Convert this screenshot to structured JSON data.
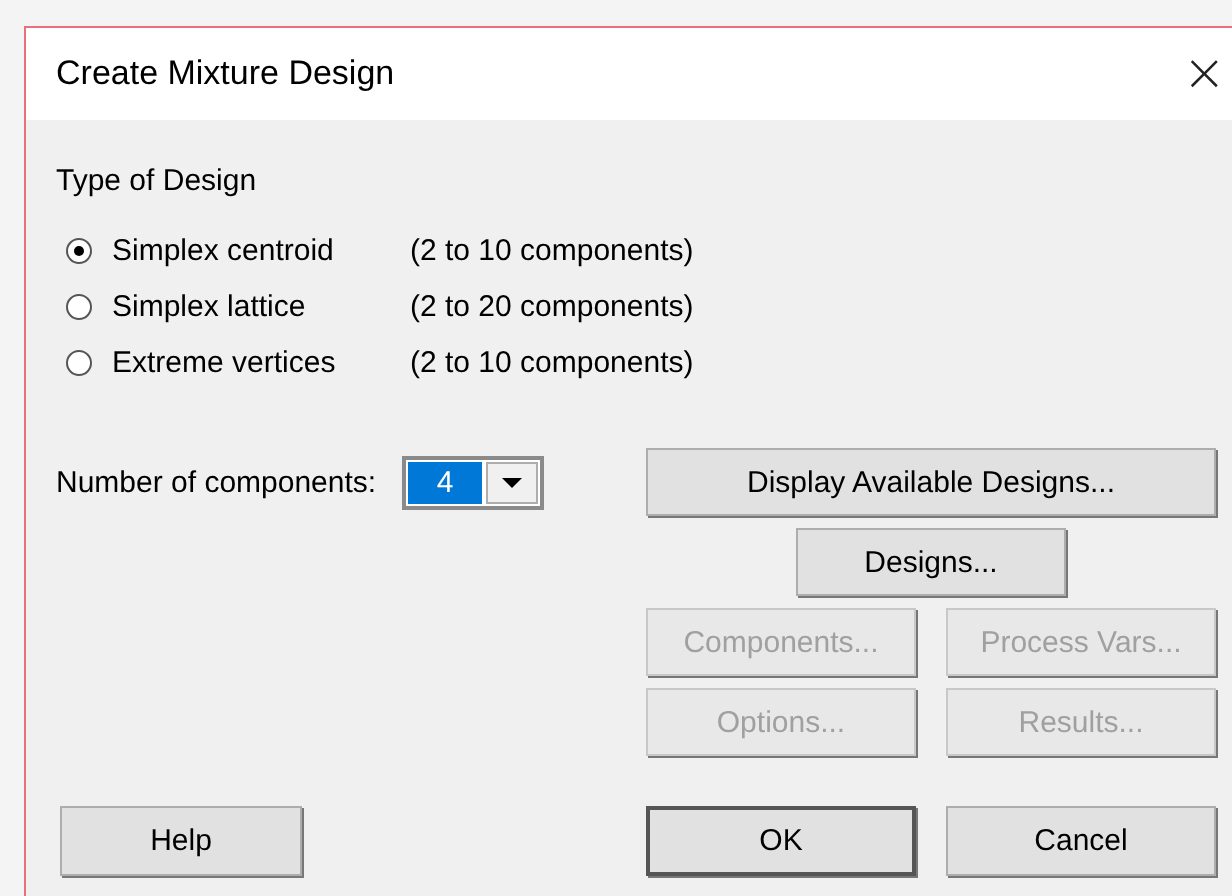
{
  "window": {
    "title": "Create Mixture Design",
    "close": "×"
  },
  "type_of_design": {
    "label": "Type of Design",
    "options": [
      {
        "label": "Simplex centroid",
        "range": "(2 to 10 components)",
        "selected": true
      },
      {
        "label": "Simplex lattice",
        "range": "(2 to 20 components)",
        "selected": false
      },
      {
        "label": "Extreme vertices",
        "range": "(2 to 10 components)",
        "selected": false
      }
    ]
  },
  "number_of_components": {
    "label": "Number of components:",
    "value": "4"
  },
  "buttons": [
    {
      "label": "Display Available Designs...",
      "disabled": false,
      "default": false
    },
    {
      "label": "Designs...",
      "disabled": false,
      "default": false
    },
    {
      "label": "Components...",
      "disabled": true,
      "default": false
    },
    {
      "label": "Process Vars...",
      "disabled": true,
      "default": false
    },
    {
      "label": "Options...",
      "disabled": true,
      "default": false
    },
    {
      "label": "Results...",
      "disabled": true,
      "default": false
    },
    {
      "label": "Help",
      "disabled": false,
      "default": false
    },
    {
      "label": "OK",
      "disabled": false,
      "default": true
    },
    {
      "label": "Cancel",
      "disabled": false,
      "default": false
    }
  ]
}
